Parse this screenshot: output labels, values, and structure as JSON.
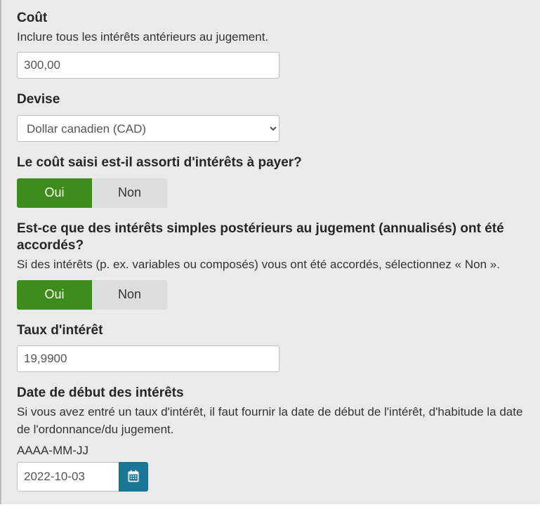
{
  "cost": {
    "label": "Coût",
    "hint": "Inclure tous les intérêts antérieurs au jugement.",
    "value": "300,00"
  },
  "currency": {
    "label": "Devise",
    "selected": "Dollar canadien (CAD)"
  },
  "has_interest": {
    "label": "Le coût saisi est-il assorti d'intérêts à payer?",
    "yes": "Oui",
    "no": "Non",
    "selected": "Oui"
  },
  "simple_interest": {
    "label": "Est-ce que des intérêts simples postérieurs au jugement (annualisés) ont été accordés?",
    "hint": "Si des intérêts (p. ex. variables ou composés) vous ont été accordés, sélectionnez « Non ».",
    "yes": "Oui",
    "no": "Non",
    "selected": "Oui"
  },
  "rate": {
    "label": "Taux d'intérêt",
    "value": "19,9900"
  },
  "start_date": {
    "label": "Date de début des intérêts",
    "hint": "Si vous avez entré un taux d'intérêt, il faut fournir la date de début de l'intérêt, d'habitude la date de l'ordonnance/du jugement.",
    "format": "AAAA-MM-JJ",
    "value": "2022-10-03"
  }
}
